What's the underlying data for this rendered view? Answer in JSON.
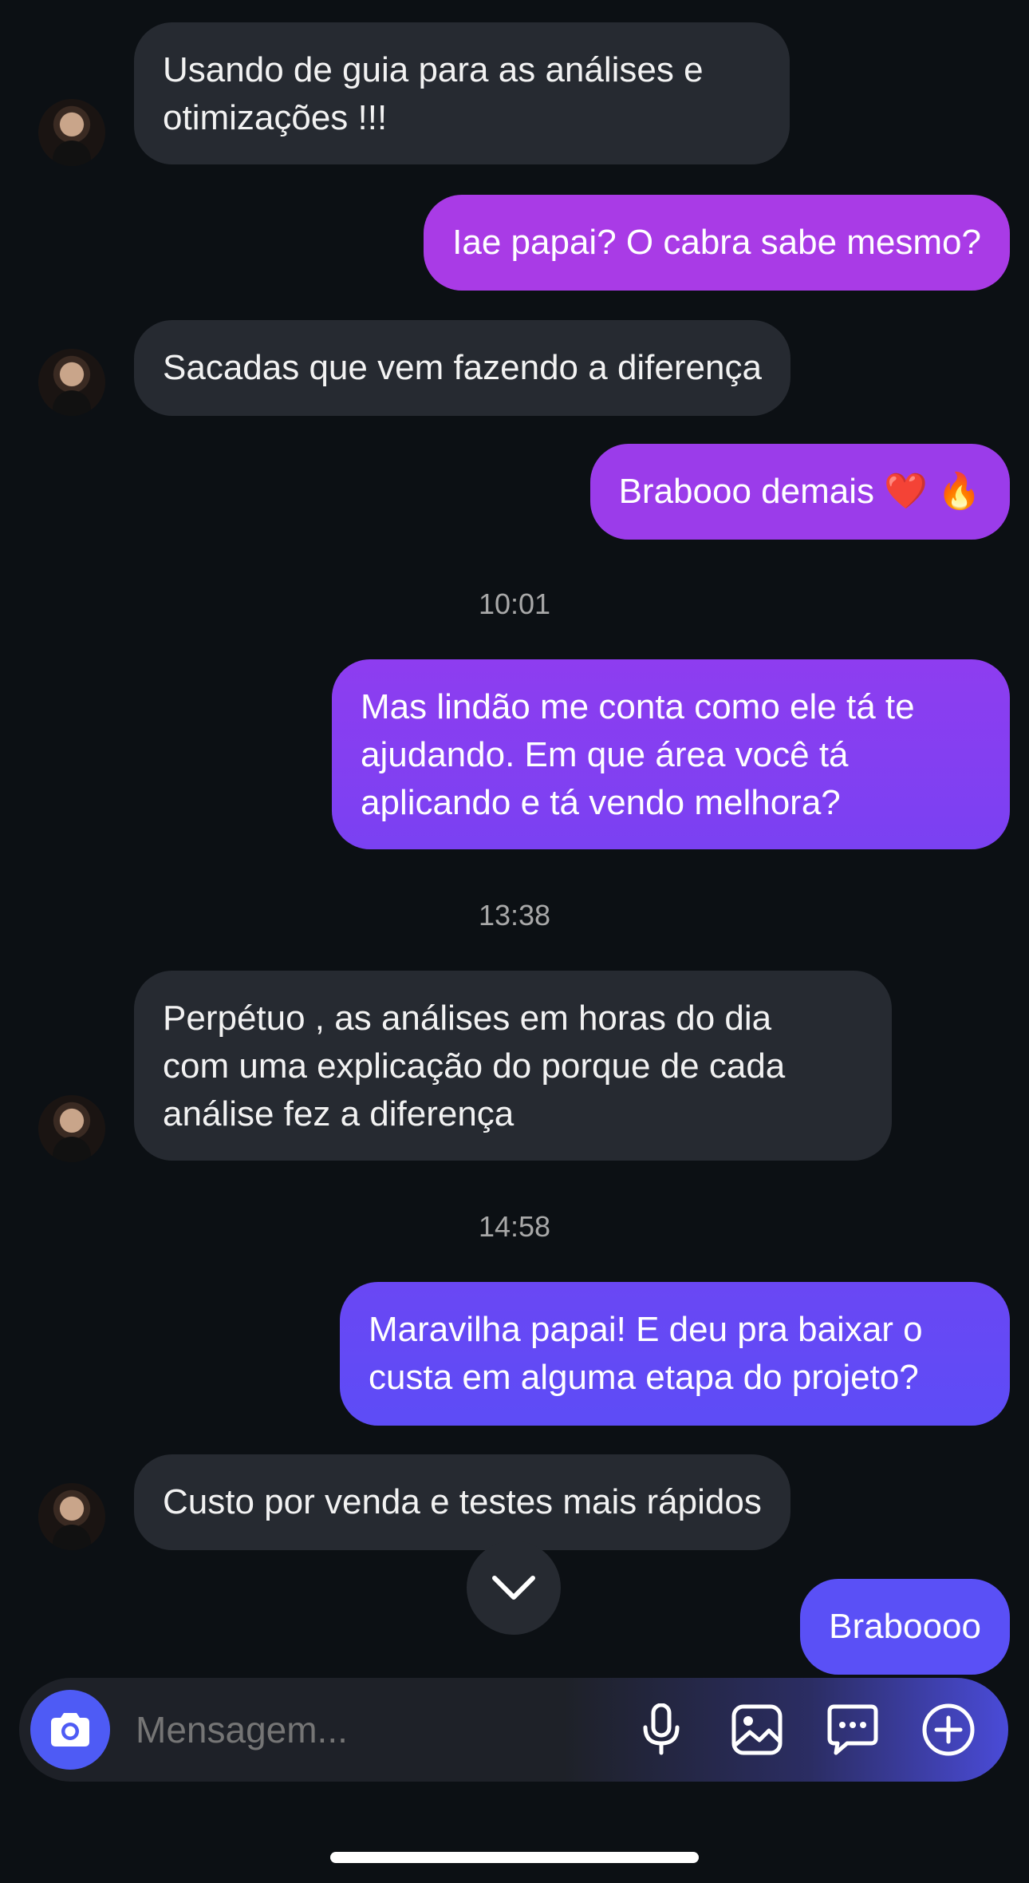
{
  "messages": [
    {
      "dir": "in",
      "text": "Usando de guia para as análises e\notimizações !!!"
    },
    {
      "dir": "out",
      "text": "Iae papai? O cabra sabe mesmo?"
    },
    {
      "dir": "in",
      "text": "Sacadas que vem fazendo a diferença"
    },
    {
      "dir": "out",
      "text": "Brabooo demais ❤️ 🔥"
    },
    {
      "dir": "time",
      "text": "10:01"
    },
    {
      "dir": "out",
      "text": "Mas lindão me conta como ele tá te\najudando. Em que área você tá\naplicando e tá vendo melhora?"
    },
    {
      "dir": "time",
      "text": "13:38"
    },
    {
      "dir": "in",
      "text": "Perpétuo , as análises em horas do dia\ncom uma explicação do porque de cada\nanálise fez a diferença"
    },
    {
      "dir": "time",
      "text": "14:58"
    },
    {
      "dir": "out",
      "text": "Maravilha papai! E deu pra baixar o\ncusta em alguma etapa do projeto?"
    },
    {
      "dir": "in",
      "text": "Custo por venda e testes mais rápidos"
    },
    {
      "dir": "out",
      "text": "Braboooo"
    }
  ],
  "composer": {
    "placeholder": "Mensagem...",
    "icons": [
      "camera-icon",
      "microphone-icon",
      "gallery-icon",
      "sticker-chat-icon",
      "plus-icon"
    ]
  },
  "scroll_button_icon": "chevron-down-icon",
  "colors": {
    "background": "#0c1014",
    "incoming_bubble": "#262a31",
    "outgoing_gradient": [
      "#b13ee0",
      "#5b4cf5"
    ],
    "camera_button": "#4e5bf5"
  }
}
